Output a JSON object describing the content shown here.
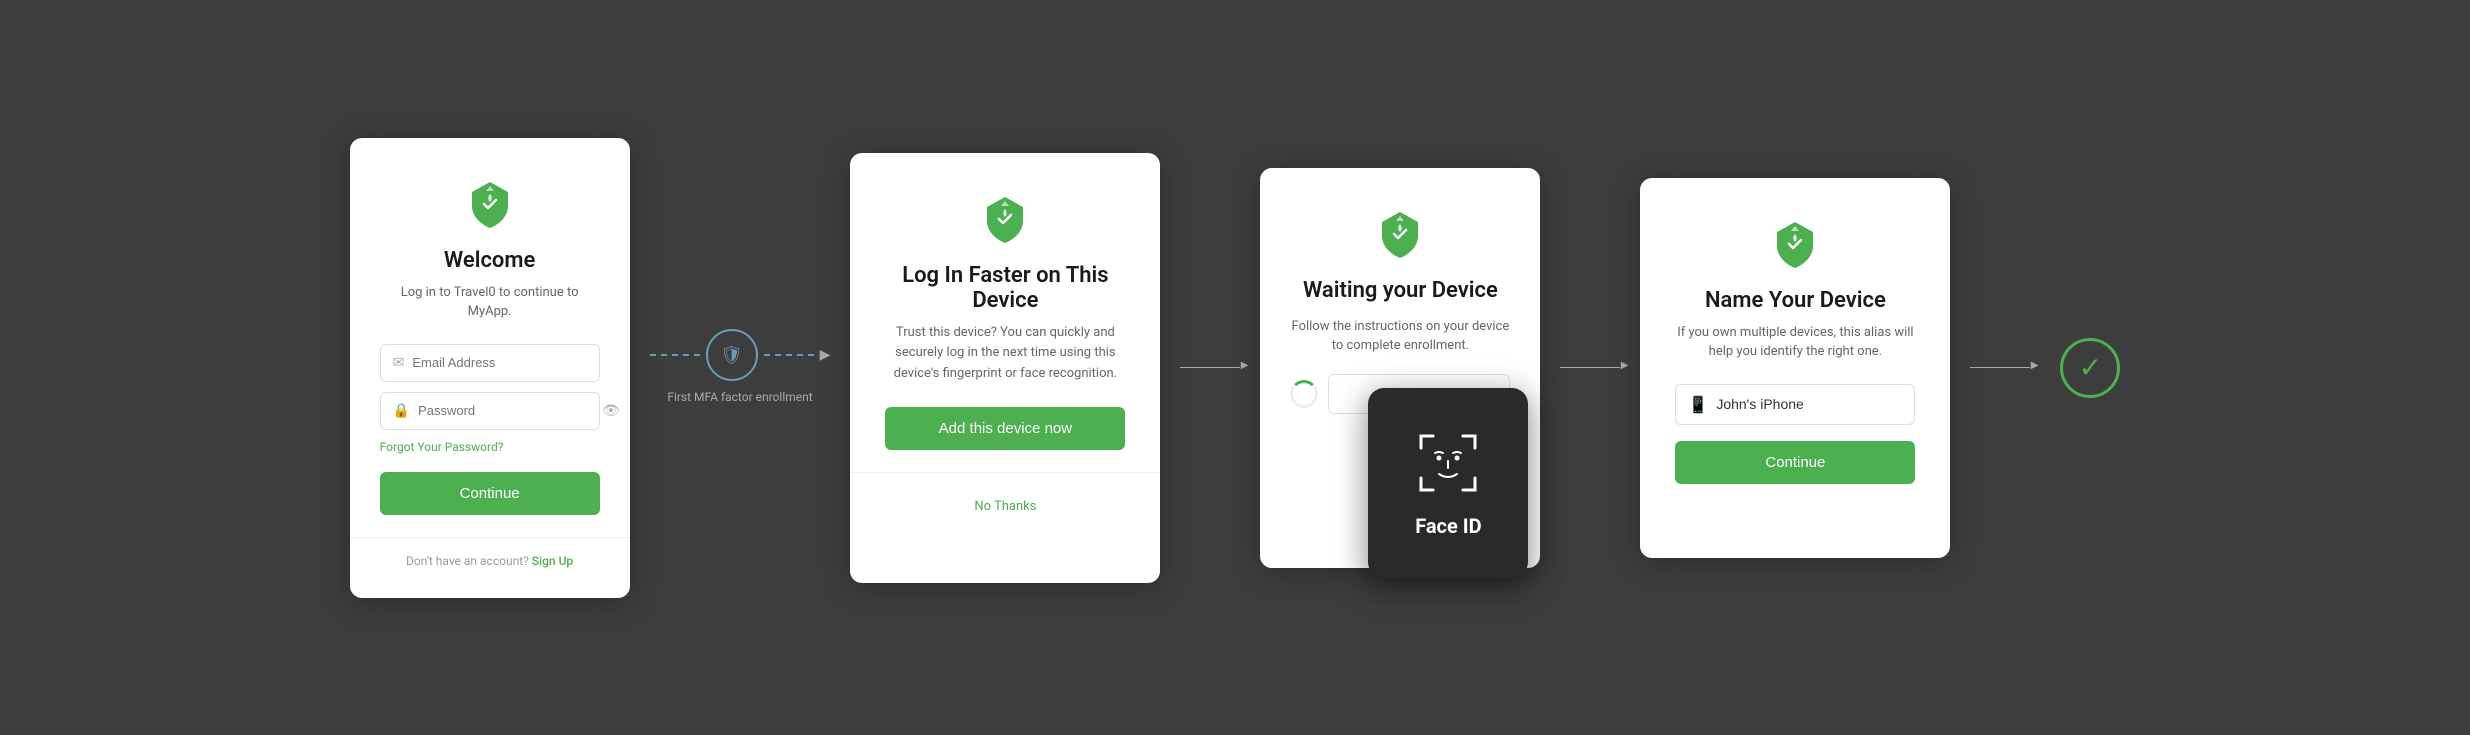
{
  "card1": {
    "logo_alt": "travel0-logo",
    "title": "Welcome",
    "subtitle": "Log in to Travel0 to continue to MyApp.",
    "email_placeholder": "Email Address",
    "password_placeholder": "Password",
    "forgot_label": "Forgot Your Password?",
    "continue_label": "Continue",
    "footer_text": "Don't have an account?",
    "signup_label": "Sign Up"
  },
  "connector1": {
    "label": "First MFA factor\nenrollment",
    "icon": "🛡"
  },
  "card2": {
    "logo_alt": "travel0-logo",
    "title": "Log In Faster on This Device",
    "description": "Trust this device? You can quickly and securely log in the next time using this device's fingerprint or face recognition.",
    "add_device_label": "Add this device now",
    "no_thanks_label": "No Thanks"
  },
  "card3": {
    "logo_alt": "travel0-logo",
    "title": "Waiting your Device",
    "subtitle": "Fol... your d...",
    "face_id_text": "Face ID"
  },
  "card4": {
    "logo_alt": "travel0-logo",
    "title": "Name Your Device",
    "subtitle": "If you own multiple devices, this alias will help you identify the right one.",
    "device_name_value": "John's iPhone",
    "continue_label": "Continue"
  },
  "success": {
    "icon": "✓"
  },
  "colors": {
    "green": "#4CAF50",
    "blue_circle": "#6b9cb8"
  }
}
